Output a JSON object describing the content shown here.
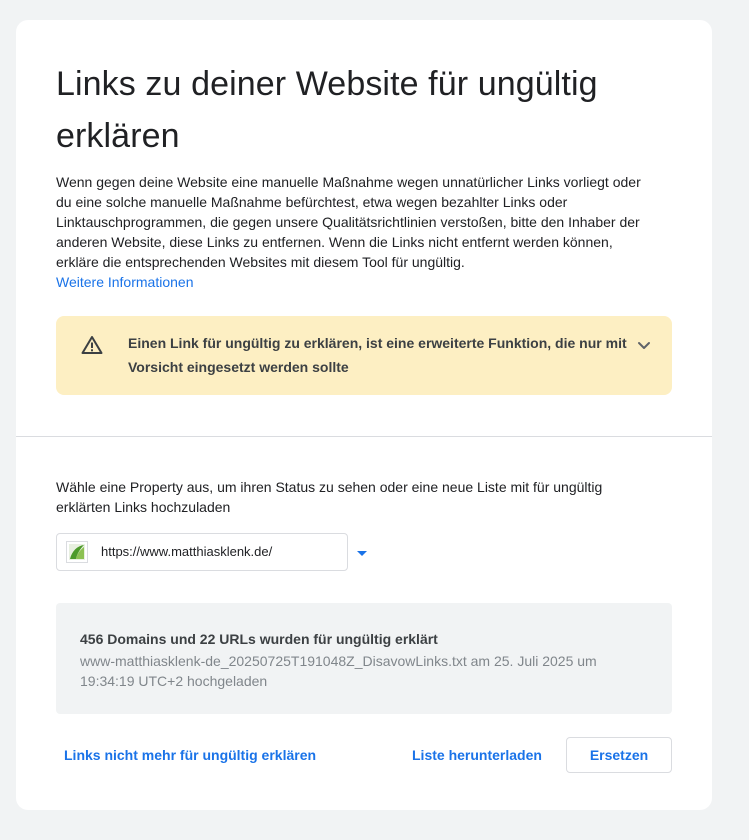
{
  "page": {
    "title": "Links zu deiner Website für ungültig erklären",
    "intro_text": "Wenn gegen deine Website eine manuelle Maßnahme wegen unnatürlicher Links vorliegt oder du eine solche manuelle Maßnahme befürchtest, etwa wegen bezahlter Links oder Linktauschprogrammen, die gegen unsere Qualitätsrichtlinien verstoßen, bitte den Inhaber der anderen Website, diese Links zu entfernen. Wenn die Links nicht entfernt werden können, erkläre die entsprechenden Websites mit diesem Tool für ungültig.",
    "learn_more_link": "Weitere Informationen"
  },
  "warning": {
    "text": "Einen Link für ungültig zu erklären, ist eine erweiterte Funktion, die nur mit Vorsicht eingesetzt werden sollte",
    "icon": "warning-triangle-icon",
    "expand_icon": "chevron-down-icon",
    "background_color": "#fdefc3"
  },
  "property": {
    "prompt": "Wähle eine Property aus, um ihren Status zu sehen oder eine neue Liste mit für ungültig erklärten Links hochzuladen",
    "selected_value": "https://www.matthiasklenk.de/",
    "favicon": "site-favicon-icon",
    "dropdown_icon": "caret-down-icon"
  },
  "status": {
    "title": "456 Domains und 22 URLs wurden für ungültig erklärt",
    "detail": "www-matthiasklenk-de_20250725T191048Z_DisavowLinks.txt am 25. Juli 2025 um 19:34:19 UTC+2 hochgeladen"
  },
  "actions": {
    "undo_label": "Links nicht mehr für ungültig erklären",
    "download_label": "Liste herunterladen",
    "replace_label": "Ersetzen"
  },
  "colors": {
    "accent": "#1a73e8",
    "background": "#f1f3f4",
    "card": "#ffffff"
  }
}
